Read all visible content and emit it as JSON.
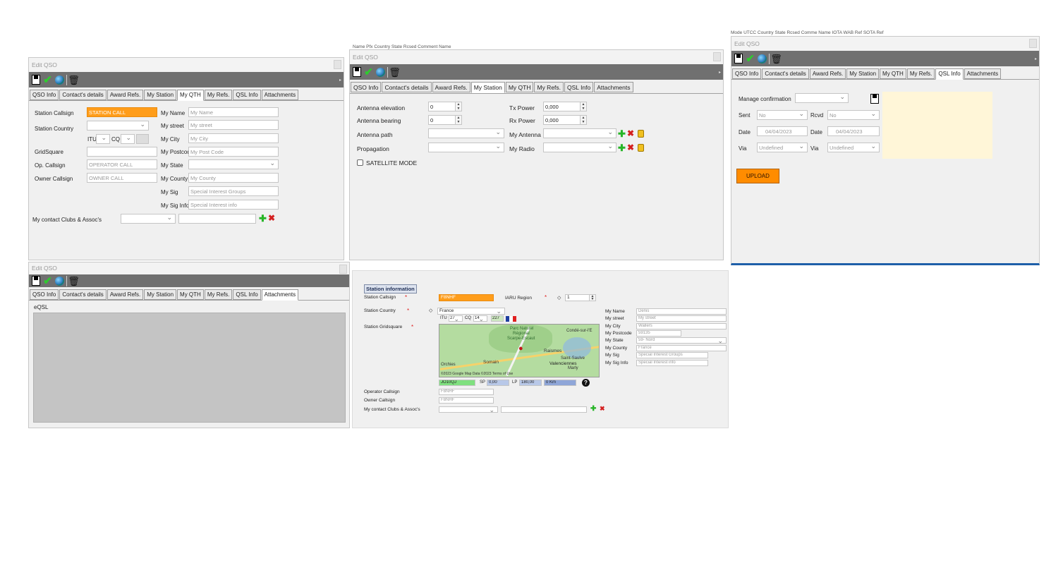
{
  "common": {
    "window_title": "Edit QSO",
    "tabs_full": [
      "QSO Info",
      "Contact's details",
      "Award Refs.",
      "My Station",
      "My QTH",
      "My Refs.",
      "QSL Info",
      "Attachments"
    ]
  },
  "bg_strip_top_mid": "Name      Pfx      Country           State   Rcsed      Comment  Name",
  "bg_strip_top_right": "Mode     UTCC    Country          State   Rcsed    Comme Name                    IOTA         WAB          Ref SOTA   Ref",
  "win1": {
    "labels": {
      "station_callsign": "Station Callsign",
      "station_country": "Station Country",
      "itu": "ITU",
      "cq": "CQ",
      "gridsquare": "GridSquare",
      "op_callsign": "Op. Callsign",
      "owner_callsign": "Owner Callsign",
      "clubs": "My contact Clubs & Assoc's",
      "my_name": "My Name",
      "my_street": "My street",
      "my_city": "My City",
      "my_postcode": "My Postcode",
      "my_state": "My State",
      "my_county": "My County",
      "my_sig": "My Sig",
      "my_sig_info": "My Sig Info"
    },
    "values": {
      "station_callsign": "STATION CALL",
      "op_callsign": "OPERATOR CALL",
      "owner_callsign": "OWNER CALL",
      "my_name": "My Name",
      "my_street": "My street",
      "my_city": "My City",
      "my_postcode": "My Post Code",
      "my_county": "My County",
      "my_sig": "Special Interest Groups",
      "my_sig_info": "Special Interest info"
    }
  },
  "win2": {
    "labels": {
      "antenna_elevation": "Antenna elevation",
      "antenna_bearing": "Antenna bearing",
      "antenna_path": "Antenna path",
      "propagation": "Propagation",
      "satellite_mode": "SATELLITE MODE",
      "tx_power": "Tx Power",
      "rx_power": "Rx Power",
      "my_antenna": "My Antenna",
      "my_radio": "My Radio"
    },
    "values": {
      "antenna_elevation": "0",
      "antenna_bearing": "0",
      "tx_power": "0,000",
      "rx_power": "0,000"
    }
  },
  "win3": {
    "tabs": [
      "QSO Info",
      "Contact's details",
      "Award Refs.",
      "My Station",
      "My QTH",
      "My Refs.",
      "QSL Info",
      "Attachments"
    ],
    "labels": {
      "manage": "Manage confirmation",
      "sent": "Sent",
      "rcvd": "Rcvd",
      "date": "Date",
      "via": "Via",
      "upload": "UPLOAD"
    },
    "values": {
      "sent": "No",
      "rcvd": "No",
      "date_sent": "04/04/2023",
      "date_rcvd": "04/04/2023",
      "via_sent": "Undefined",
      "via_rcvd": "Undefined"
    }
  },
  "win4": {
    "tabs": [
      "QSO Info",
      "Contact's details",
      "Award Refs.",
      "My Station",
      "My QTH",
      "My Refs.",
      "QSL Info",
      "Attachments"
    ],
    "eqsl_label": "eQSL"
  },
  "win5": {
    "section_title": "Station information",
    "labels": {
      "station_callsign": "Station Callsign",
      "iaru_region": "IARU Region",
      "station_country": "Station Country",
      "itu": "ITU",
      "cq": "CQ",
      "gridsquare": "Station Gridsquare",
      "operator_callsign": "Operator Callsign",
      "owner_callsign": "Owner Callsign",
      "clubs": "My contact Clubs & Assoc's",
      "sp": "SP",
      "lp": "LP",
      "my_name": "My Name",
      "my_street": "My street",
      "my_city": "My City",
      "my_postcode": "My Postcode",
      "my_state": "My State",
      "my_county": "My County",
      "my_sig": "My Sig",
      "my_sig_info": "My Sig Info"
    },
    "values": {
      "station_callsign": "F8NHF",
      "iaru_region": "1",
      "station_country": "France",
      "itu": "27",
      "cq": "14",
      "dxcc": "227",
      "gridsquare": "JO10QJ",
      "sp": "0,00",
      "lp": "180,00",
      "distance": "0 Km",
      "operator_callsign": "F8NHF",
      "owner_callsign": "F8NHF",
      "my_name": "Denis",
      "my_street": "My street",
      "my_city": "Wallers",
      "my_postcode": "59135",
      "my_state": "59- Nord",
      "my_county": "France",
      "my_sig": "Special Interest Groups",
      "my_sig_info": "Special Interest info"
    },
    "map": {
      "labels": [
        "Parc Naturel",
        "Régional",
        "Scarpe-Escaut",
        "Condé-sur-l'E",
        "Raismes",
        "Saint-Saulve",
        "Valenciennes",
        "Marly",
        "Somain",
        "Orchies"
      ],
      "attribution": "©2023 Google  Map Data ©2023 Terms of Use"
    }
  }
}
